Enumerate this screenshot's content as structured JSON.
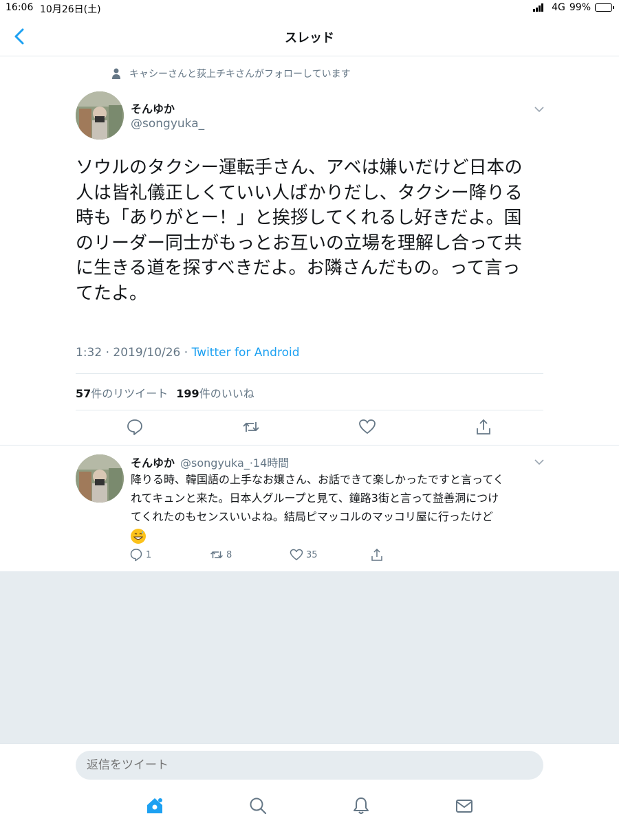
{
  "status_bar": {
    "time": "16:06",
    "date": "10月26日(土)",
    "network": "4G",
    "battery": "99%",
    "battery_level": 0.99
  },
  "header": {
    "title": "スレッド"
  },
  "social_context": "キャシーさんと荻上チキさんがフォローしています",
  "main_tweet": {
    "name": "そんゆか",
    "handle": "@songyuka_",
    "text": "ソウルのタクシー運転手さん、アベは嫌いだけど日本の\n人は皆礼儀正しくていい人ばかりだし、タクシー降りる\n時も「ありがとー！」と挨拶してくれるし好きだよ。国\nのリーダー同士がもっとお互いの立場を理解し合って共\nに生きる道を探すべきだよ。お隣さんだもの。って言っ\nてたよ。",
    "timestamp": "1:32 · 2019/10/26 · ",
    "source": "Twitter for Android",
    "retweet_count": "57",
    "retweet_label": "件のリツイート",
    "like_count": "199",
    "like_label": "件のいいね"
  },
  "reply_tweet": {
    "name": "そんゆか",
    "handle_time": "@songyuka_·14時間",
    "text": "降りる時、韓国語の上手なお嬢さん、お話できて楽しかったですと言ってく\nれてキュンと来た。日本人グループと見て、鐘路3街と言って益善洞につけ\nてくれたのもセンスいいよね。結局ピマッコルのマッコリ屋に行ったけど\n",
    "reply_count": "1",
    "retweet_count": "8",
    "like_count": "35"
  },
  "compose": {
    "placeholder": "返信をツイート"
  },
  "colors": {
    "accent": "#1da1f2",
    "secondary_text": "#657786",
    "divider": "#e1e8ed",
    "background_gray": "#e6ecf0"
  },
  "icons": {
    "back": "chevron-left-icon",
    "reply": "reply-icon",
    "retweet": "retweet-icon",
    "like": "heart-icon",
    "share": "share-icon",
    "home": "home-icon",
    "search": "search-icon",
    "notifications": "bell-icon",
    "messages": "envelope-icon"
  }
}
